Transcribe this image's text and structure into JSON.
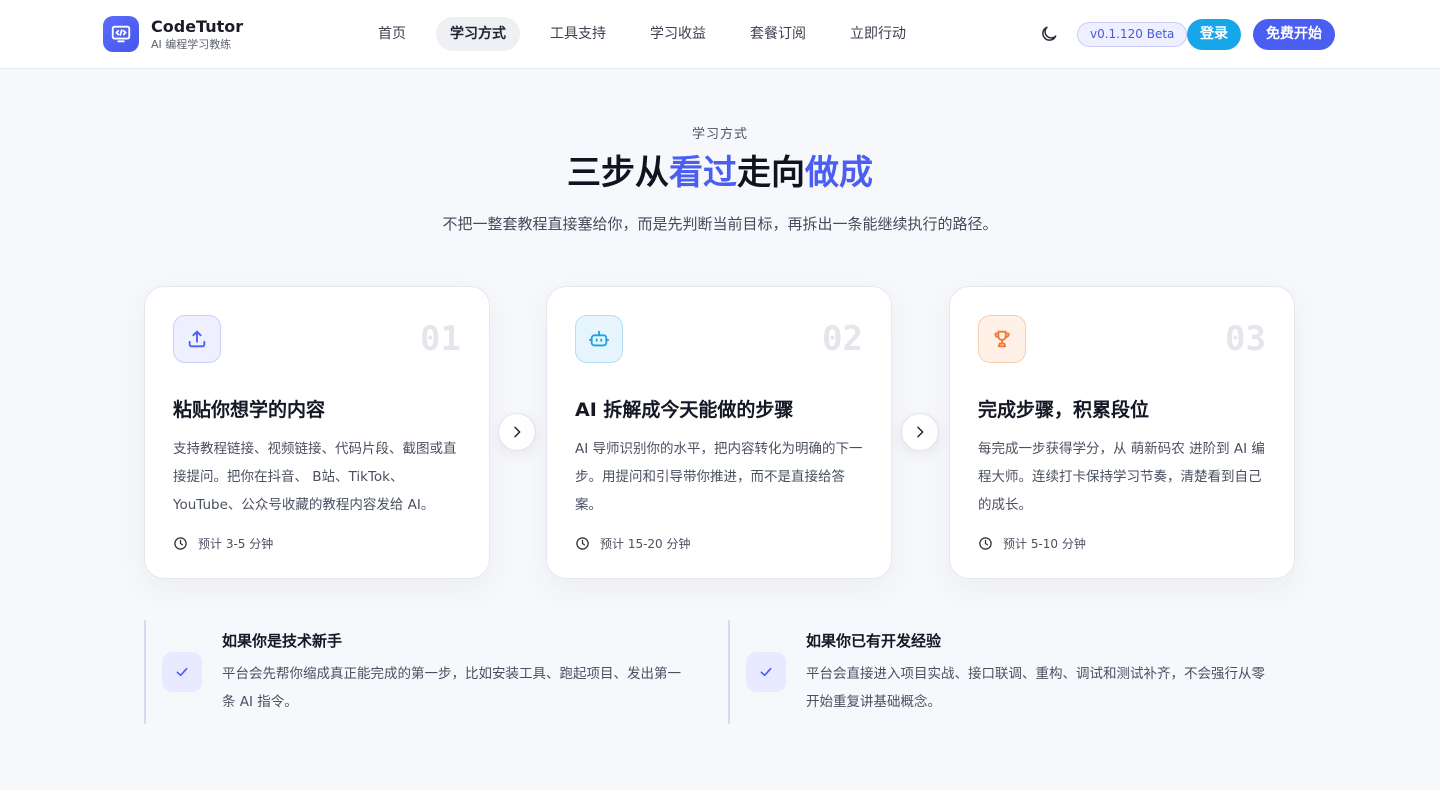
{
  "brand": {
    "name": "CodeTutor",
    "tagline": "AI 编程学习教练"
  },
  "nav": {
    "items": [
      {
        "label": "首页",
        "active": false
      },
      {
        "label": "学习方式",
        "active": true
      },
      {
        "label": "工具支持",
        "active": false
      },
      {
        "label": "学习收益",
        "active": false
      },
      {
        "label": "套餐订阅",
        "active": false
      },
      {
        "label": "立即行动",
        "active": false
      }
    ],
    "theme_icon": "moon-icon",
    "version": "v0.1.120 Beta",
    "login_label": "登录",
    "start_label": "免费开始"
  },
  "hero": {
    "eyebrow": "学习方式",
    "title_part1": "三步从",
    "title_hl1": "看过",
    "title_part2": "走向",
    "title_hl2": "做成",
    "subtitle": "不把一整套教程直接塞给你，而是先判断当前目标，再拆出一条能继续执行的路径。"
  },
  "steps": [
    {
      "number": "01",
      "icon": "upload-icon",
      "title": "粘贴你想学的内容",
      "desc": "支持教程链接、视频链接、代码片段、截图或直接提问。把你在抖音、 B站、TikTok、YouTube、公众号收藏的教程内容发给 AI。",
      "time": "预计 3-5 分钟"
    },
    {
      "number": "02",
      "icon": "robot-icon",
      "title": "AI 拆解成今天能做的步骤",
      "desc": "AI 导师识别你的水平，把内容转化为明确的下一步。用提问和引导带你推进，而不是直接给答案。",
      "time": "预计 15-20 分钟"
    },
    {
      "number": "03",
      "icon": "trophy-icon",
      "title": "完成步骤，积累段位",
      "desc": "每完成一步获得学分，从 萌新码农 进阶到 AI 编程大师。连续打卡保持学习节奏，清楚看到自己的成长。",
      "time": "预计 5-10 分钟"
    }
  ],
  "tips": [
    {
      "title": "如果你是技术新手",
      "desc": "平台会先帮你缩成真正能完成的第一步，比如安装工具、跑起项目、发出第一条 AI 指令。"
    },
    {
      "title": "如果你已有开发经验",
      "desc": "平台会直接进入项目实战、接口联调、重构、调试和测试补齐，不会强行从零开始重复讲基础概念。"
    }
  ],
  "colors": {
    "accent": "#4b5ef2",
    "login": "#17a7e8",
    "step1_icon_bg": "#eef0ff",
    "step2_icon_bg": "#e6f5fd",
    "step3_icon_bg": "#fff1e8"
  }
}
